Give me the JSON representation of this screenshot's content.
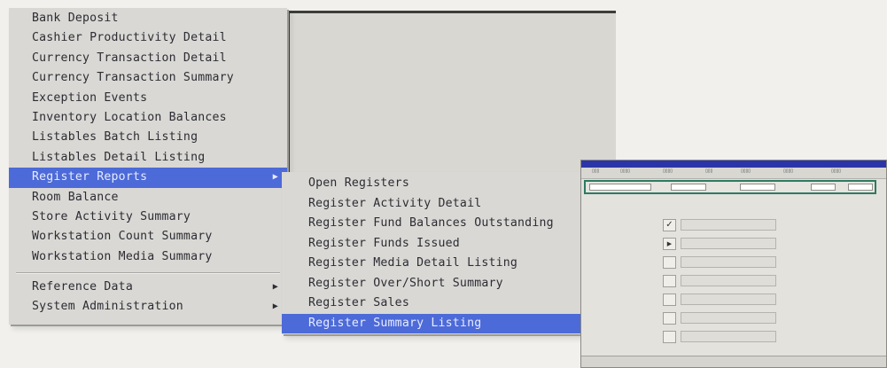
{
  "main_menu": {
    "items": [
      {
        "label": "Bank Deposit"
      },
      {
        "label": "Cashier Productivity Detail"
      },
      {
        "label": "Currency Transaction Detail"
      },
      {
        "label": "Currency Transaction Summary"
      },
      {
        "label": "Exception Events"
      },
      {
        "label": "Inventory Location Balances"
      },
      {
        "label": "Listables Batch Listing"
      },
      {
        "label": "Listables Detail Listing"
      },
      {
        "label": "Register Reports",
        "submenu": true,
        "selected": true
      },
      {
        "label": "Room Balance"
      },
      {
        "label": "Store Activity Summary"
      },
      {
        "label": "Workstation Count Summary"
      },
      {
        "label": "Workstation Media Summary"
      }
    ],
    "footer_items": [
      {
        "label": "Reference Data",
        "submenu": true
      },
      {
        "label": "System Administration",
        "submenu": true
      }
    ]
  },
  "register_submenu": {
    "items": [
      {
        "label": "Open Registers"
      },
      {
        "label": "Register Activity Detail"
      },
      {
        "label": "Register Fund Balances Outstanding"
      },
      {
        "label": "Register Funds Issued"
      },
      {
        "label": "Register Media Detail Listing"
      },
      {
        "label": "Register Over/Short Summary"
      },
      {
        "label": "Register Sales"
      },
      {
        "label": "Register Summary Listing",
        "selected": true
      }
    ]
  },
  "icons": {
    "submenu_arrow": "triangle-right-icon",
    "check": "check-icon",
    "play": "play-icon"
  },
  "colors": {
    "menu_background": "#d9d8d4",
    "selection": "#4c6ad8",
    "menu_text": "#2d2c34",
    "mini_title_bar": "#2c35a8",
    "mini_field_border": "#2d7a63"
  }
}
